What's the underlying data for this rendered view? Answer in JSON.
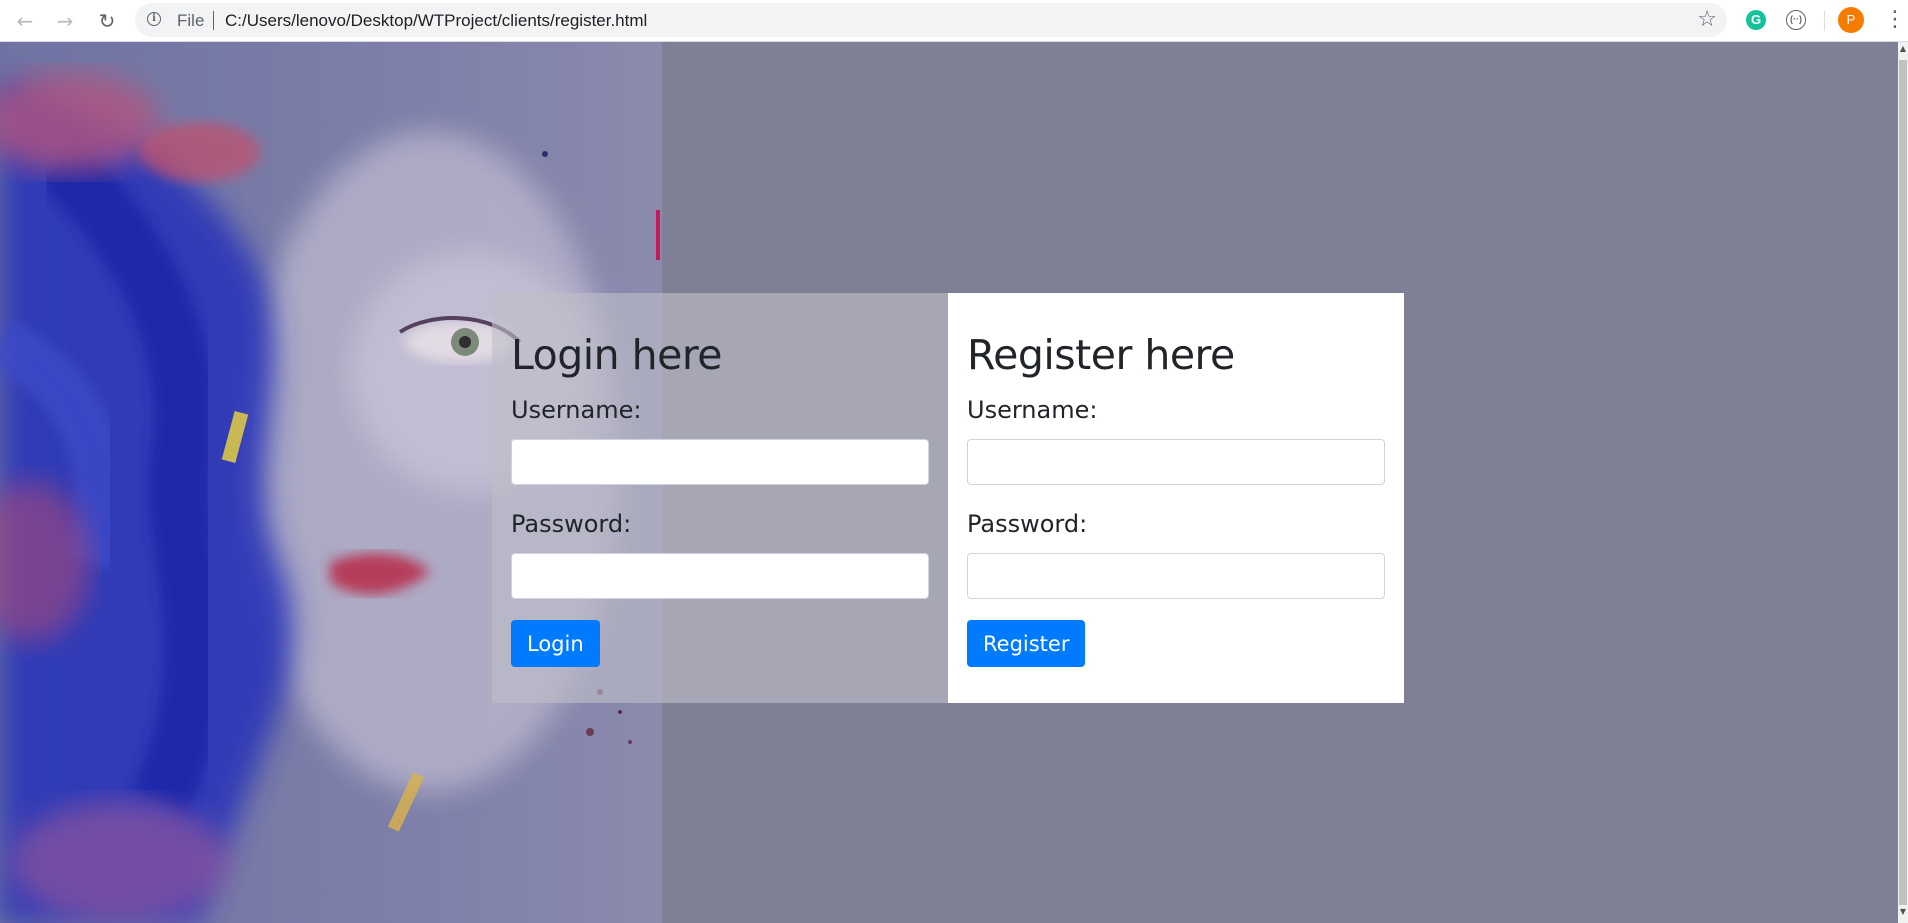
{
  "browser": {
    "scheme_label": "File",
    "url": "C:/Users/lenovo/Desktop/WTProject/clients/register.html",
    "profile_initial": "P",
    "extension_grammarly": "G",
    "extension_other": "(··)"
  },
  "login": {
    "title": "Login here",
    "username_label": "Username:",
    "username_value": "",
    "password_label": "Password:",
    "password_value": "",
    "button_label": "Login"
  },
  "register": {
    "title": "Register here",
    "username_label": "Username:",
    "username_value": "",
    "password_label": "Password:",
    "password_value": "",
    "button_label": "Register"
  },
  "colors": {
    "page_background": "#7f7f96",
    "primary_button": "#007bff",
    "register_panel": "#ffffff"
  },
  "icons": {
    "back": "back-arrow-icon",
    "forward": "forward-arrow-icon",
    "reload": "reload-icon",
    "info": "info-icon",
    "bookmark": "star-icon",
    "menu": "vertical-dots-icon"
  }
}
